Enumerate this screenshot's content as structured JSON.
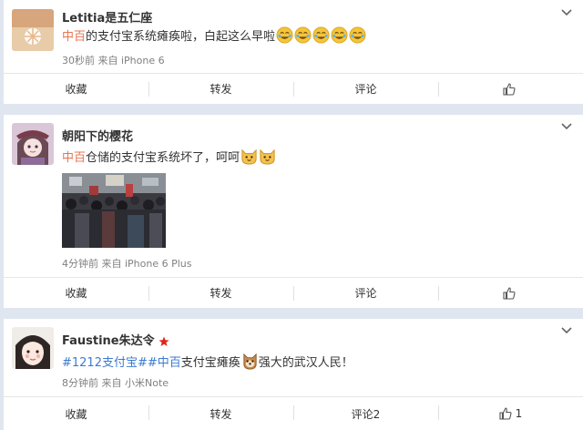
{
  "posts": [
    {
      "username": "Letitia是五仁座",
      "text_shop": "中百",
      "text_rest": "的支付宝系统瘫痪啦，白起这么早啦",
      "meta": "30秒前 来自 iPhone 6",
      "actions": {
        "collect": "收藏",
        "repost": "转发",
        "comment": "评论",
        "like": ""
      }
    },
    {
      "username": "朝阳下的樱花",
      "text_shop": "中百",
      "text_rest": "仓储的支付宝系统坏了，呵呵",
      "meta": "4分钟前 来自 iPhone 6 Plus",
      "actions": {
        "collect": "收藏",
        "repost": "转发",
        "comment": "评论",
        "like": ""
      }
    },
    {
      "username": "Faustine朱达令",
      "topic": "#1212支付宝#",
      "topic_shop": "#中百",
      "text_mid": "支付宝瘫痪",
      "text_end": "强大的武汉人民！",
      "meta": "8分钟前 来自 小米Note",
      "actions": {
        "collect": "收藏",
        "repost": "转发",
        "comment": "评论2",
        "like": "1"
      }
    }
  ],
  "icons": {
    "chevron": "chevron-down-icon",
    "like": "thumbs-up-icon",
    "laugh_emoji": "laugh-cry-emoji",
    "cat_emoji": "cat-emoji",
    "dog_emoji": "dog-emoji",
    "badge": "red-star-badge-icon"
  },
  "colors": {
    "background": "#dfe6f0",
    "shop_link": "#eb7350",
    "topic_link": "#3c7bd0",
    "meta_text": "#808080"
  }
}
